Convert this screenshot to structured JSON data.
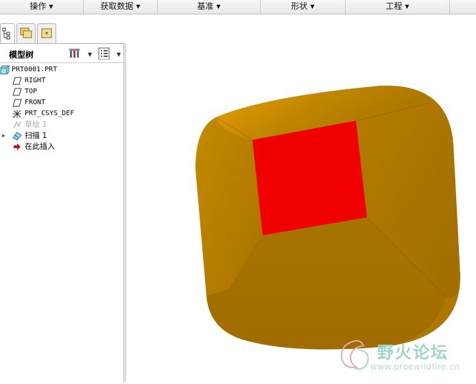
{
  "menubar": {
    "items": [
      {
        "label": "操作"
      },
      {
        "label": "获取数据"
      },
      {
        "label": "基准"
      },
      {
        "label": "形状"
      },
      {
        "label": "工程"
      }
    ]
  },
  "model_tree": {
    "title": "模型树",
    "items": [
      {
        "label": "PRT0001.PRT",
        "icon": "part-icon"
      },
      {
        "label": "RIGHT",
        "icon": "datum-plane-icon"
      },
      {
        "label": "TOP",
        "icon": "datum-plane-icon"
      },
      {
        "label": "FRONT",
        "icon": "datum-plane-icon"
      },
      {
        "label": "PRT_CSYS_DEF",
        "icon": "coordinate-system-icon"
      },
      {
        "label": "草绘 1",
        "icon": "sketch-icon",
        "state": "dimmed"
      },
      {
        "label": "扫描 1",
        "icon": "sweep-icon"
      },
      {
        "label": "在此插入",
        "icon": "insert-here-arrow-icon"
      }
    ]
  },
  "viewport": {
    "model_colors": {
      "body": "#b27a00",
      "highlight": "#e5a000",
      "selected_face": "#f00000"
    }
  },
  "watermark": {
    "brand": "野火论坛",
    "url": "www.proewildfire.cn"
  }
}
